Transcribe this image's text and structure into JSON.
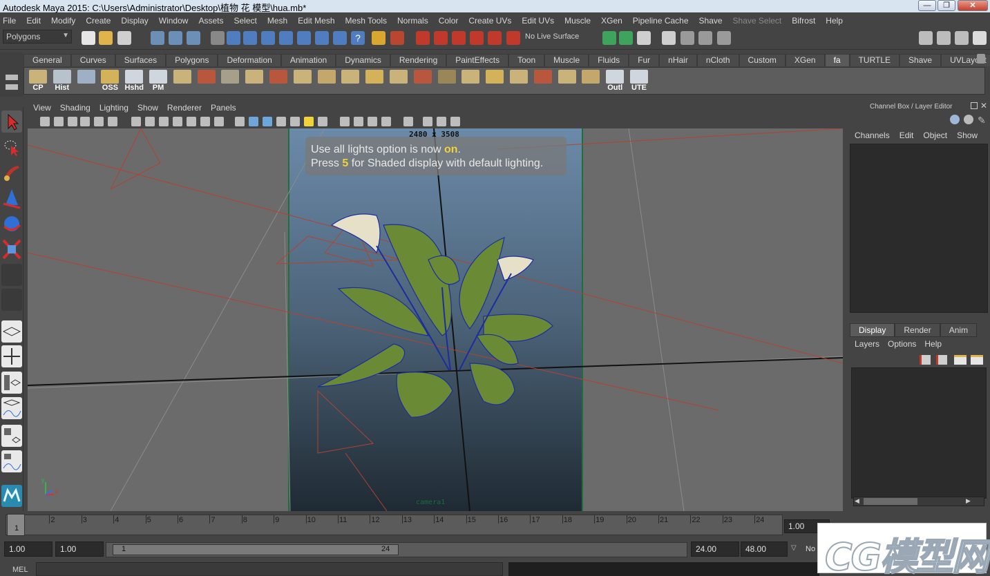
{
  "window": {
    "title": "Autodesk Maya 2015: C:\\Users\\Administrator\\Desktop\\植物  花  模型\\hua.mb*",
    "controls": [
      "—",
      "❐",
      "✕"
    ]
  },
  "menubar": {
    "items": [
      "File",
      "Edit",
      "Modify",
      "Create",
      "Display",
      "Window",
      "Assets",
      "Select",
      "Mesh",
      "Edit Mesh",
      "Mesh Tools",
      "Normals",
      "Color",
      "Create UVs",
      "Edit UVs",
      "Muscle",
      "XGen",
      "Pipeline Cache",
      "Shave",
      "Shave Select",
      "Bifrost",
      "Help"
    ]
  },
  "statusline": {
    "menuset": "Polygons",
    "live_surface": "No Live Surface"
  },
  "shelf": {
    "tabs": [
      "General",
      "Curves",
      "Surfaces",
      "Polygons",
      "Deformation",
      "Animation",
      "Dynamics",
      "Rendering",
      "PaintEffects",
      "Toon",
      "Muscle",
      "Fluids",
      "Fur",
      "nHair",
      "nCloth",
      "Custom",
      "XGen",
      "fa",
      "TURTLE",
      "Shave",
      "UVLayout"
    ],
    "active_tab": "fa",
    "buttons": [
      {
        "label": "CP",
        "icon": "axis-pivot-icon"
      },
      {
        "label": "Hist",
        "icon": "history-icon"
      },
      {
        "label": "",
        "icon": "shelf-tool-icon"
      },
      {
        "label": "OSS",
        "icon": "folder-icon"
      },
      {
        "label": "Hshd",
        "icon": "hypershade-icon"
      },
      {
        "label": "PM",
        "icon": "panel-icon"
      },
      {
        "label": "",
        "icon": "shelf-tool-icon"
      },
      {
        "label": "",
        "icon": "shelf-tool-icon"
      },
      {
        "label": "",
        "icon": "sphere-material-icon"
      },
      {
        "label": "",
        "icon": "shelf-tool-icon"
      },
      {
        "label": "",
        "icon": "shelf-tool-icon"
      },
      {
        "label": "",
        "icon": "shelf-tool-icon"
      },
      {
        "label": "",
        "icon": "shelf-tool-icon"
      },
      {
        "label": "",
        "icon": "shelf-tool-icon"
      },
      {
        "label": "",
        "icon": "shelf-tool-icon"
      },
      {
        "label": "",
        "icon": "shelf-tool-icon"
      },
      {
        "label": "",
        "icon": "shelf-tool-icon"
      },
      {
        "label": "",
        "icon": "shelf-tool-icon"
      },
      {
        "label": "",
        "icon": "shelf-tool-icon"
      },
      {
        "label": "",
        "icon": "shelf-tool-icon"
      },
      {
        "label": "",
        "icon": "shelf-tool-icon"
      },
      {
        "label": "",
        "icon": "shelf-tool-icon"
      },
      {
        "label": "",
        "icon": "shelf-tool-icon"
      },
      {
        "label": "",
        "icon": "shelf-tool-icon"
      },
      {
        "label": "Outl",
        "icon": "outliner-icon"
      },
      {
        "label": "UTE",
        "icon": "uv-editor-icon"
      }
    ]
  },
  "viewport": {
    "menus": [
      "View",
      "Shading",
      "Lighting",
      "Show",
      "Renderer",
      "Panels"
    ],
    "resolution": "2480 x 3508",
    "camera": "camera1",
    "hud_line1_pre": "Use all lights option is now ",
    "hud_line1_hl": "on",
    "hud_line1_post": ".",
    "hud_line2_pre": "Press ",
    "hud_line2_hl": "5",
    "hud_line2_post": " for Shaded display with default lighting.",
    "axis": {
      "y": "y",
      "x": "x",
      "z": "z"
    }
  },
  "channel_box": {
    "title": "Channel Box / Layer Editor",
    "menus": [
      "Channels",
      "Edit",
      "Object",
      "Show"
    ]
  },
  "layer_editor": {
    "tabs": [
      "Display",
      "Render",
      "Anim"
    ],
    "active_tab": "Display",
    "menus": [
      "Layers",
      "Options",
      "Help"
    ]
  },
  "time_slider": {
    "ticks": [
      "1",
      "2",
      "3",
      "4",
      "5",
      "6",
      "7",
      "8",
      "9",
      "10",
      "11",
      "12",
      "13",
      "14",
      "15",
      "16",
      "17",
      "18",
      "19",
      "20",
      "21",
      "22",
      "23",
      "24"
    ],
    "current_frame": "1",
    "current_time": "1.00"
  },
  "range_slider": {
    "anim_start": "1.00",
    "playback_start": "1.00",
    "range_start_label": "1",
    "range_end_label": "24",
    "playback_end": "24.00",
    "anim_end": "48.00",
    "extra": "No"
  },
  "command_line": {
    "label": "MEL"
  },
  "watermark": {
    "text": "CG模型网"
  },
  "colors": {
    "ui_bg": "#444444",
    "viewport_bg": "#6b6b6b",
    "hud_highlight": "#f0d33a",
    "gate_border": "#1e6f3b",
    "leaf_green": "#6a8a35",
    "wire_blue": "#1c2da0"
  }
}
